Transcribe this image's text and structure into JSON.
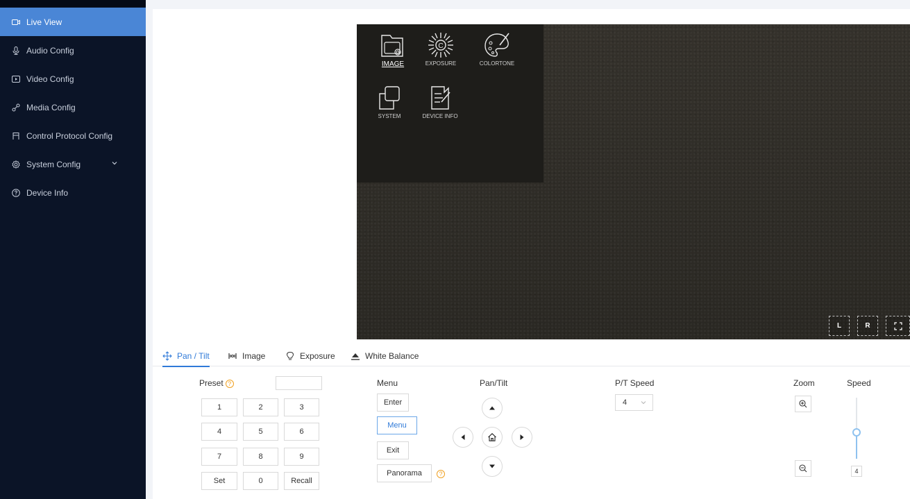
{
  "sidebar": {
    "items": [
      {
        "label": "Live View",
        "icon": "video-camera-icon",
        "active": true
      },
      {
        "label": "Audio Config",
        "icon": "microphone-icon"
      },
      {
        "label": "Video Config",
        "icon": "video-screen-icon"
      },
      {
        "label": "Media Config",
        "icon": "link-icon"
      },
      {
        "label": "Control Protocol Config",
        "icon": "protocol-icon"
      },
      {
        "label": "System Config",
        "icon": "gear-icon",
        "expandable": true
      },
      {
        "label": "Device Info",
        "icon": "info-circle-icon"
      }
    ]
  },
  "video": {
    "osd_menu": [
      {
        "label": "IMAGE",
        "icon": "image-folder-icon",
        "selected": true
      },
      {
        "label": "EXPOSURE",
        "icon": "exposure-sun-icon"
      },
      {
        "label": "COLORTONE",
        "icon": "palette-icon"
      },
      {
        "label": "SYSTEM",
        "icon": "system-squares-icon"
      },
      {
        "label": "DEVICE INFO",
        "icon": "device-info-doc-icon"
      }
    ],
    "buttons": {
      "left": "L",
      "right": "R",
      "fullscreen_icon": "fullscreen-icon"
    }
  },
  "tabs": [
    {
      "label": "Pan / Tilt",
      "icon": "move-cross-icon",
      "active": true
    },
    {
      "label": "Image",
      "icon": "image-adjust-icon"
    },
    {
      "label": "Exposure",
      "icon": "bulb-icon"
    },
    {
      "label": "White Balance",
      "icon": "white-balance-icon"
    }
  ],
  "preset": {
    "label": "Preset",
    "input_value": "",
    "keys": [
      "1",
      "2",
      "3",
      "4",
      "5",
      "6",
      "7",
      "8",
      "9",
      "Set",
      "0",
      "Recall"
    ]
  },
  "menu": {
    "label": "Menu",
    "buttons": [
      "Enter",
      "Menu",
      "Exit",
      "Panorama"
    ]
  },
  "pantilt": {
    "label": "Pan/Tilt"
  },
  "pt_speed": {
    "label": "P/T Speed",
    "value": "4"
  },
  "zoom": {
    "label": "Zoom"
  },
  "speed": {
    "label": "Speed",
    "value": "4",
    "level_fraction": 0.43
  },
  "colors": {
    "accent": "#4a86d6",
    "sidebar_bg": "#0b1427",
    "warn": "#f0a020"
  }
}
